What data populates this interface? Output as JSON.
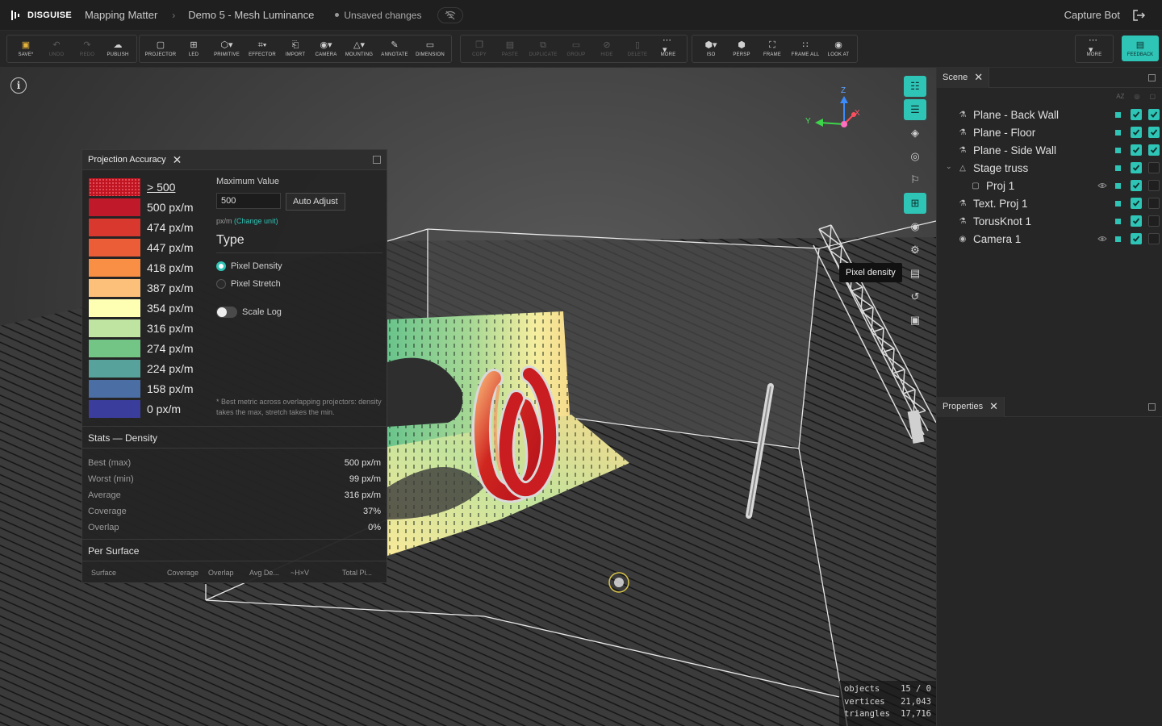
{
  "topbar": {
    "brand": "DISGUISE",
    "crumbs": [
      "Mapping Matter",
      "Demo 5 - Mesh Luminance"
    ],
    "unsaved": "Unsaved changes",
    "user": "Capture Bot"
  },
  "toolbar": {
    "file": [
      {
        "label": "SAVE*",
        "icon": "save-icon"
      },
      {
        "label": "UNDO",
        "icon": "undo-icon"
      },
      {
        "label": "REDO",
        "icon": "redo-icon"
      },
      {
        "label": "PUBLISH",
        "icon": "cloud-upload-icon"
      }
    ],
    "create": [
      {
        "label": "PROJECTOR",
        "icon": "projector-icon"
      },
      {
        "label": "LED",
        "icon": "led-grid-icon"
      },
      {
        "label": "PRIMITIVE",
        "icon": "cube-icon"
      },
      {
        "label": "EFFECTOR",
        "icon": "effector-grid-icon"
      },
      {
        "label": "IMPORT",
        "icon": "import-file-icon"
      },
      {
        "label": "CAMERA",
        "icon": "camera-icon"
      },
      {
        "label": "MOUNTING",
        "icon": "truss-icon"
      },
      {
        "label": "ANNOTATE",
        "icon": "pencil-icon"
      },
      {
        "label": "DIMENSION",
        "icon": "ruler-icon"
      }
    ],
    "edit": [
      {
        "label": "COPY",
        "icon": "copy-icon"
      },
      {
        "label": "PASTE",
        "icon": "paste-icon"
      },
      {
        "label": "DUPLICATE",
        "icon": "duplicate-icon"
      },
      {
        "label": "GROUP",
        "icon": "folder-icon"
      },
      {
        "label": "HIDE",
        "icon": "hide-icon"
      },
      {
        "label": "DELETE",
        "icon": "trash-icon"
      },
      {
        "label": "MORE",
        "icon": "more-icon"
      }
    ],
    "view": [
      {
        "label": "ISO",
        "icon": "iso-cube-icon"
      },
      {
        "label": "PERSP",
        "icon": "persp-cube-icon"
      },
      {
        "label": "FRAME",
        "icon": "frame-icon"
      },
      {
        "label": "FRAME ALL",
        "icon": "frame-all-icon"
      },
      {
        "label": "LOOK AT",
        "icon": "eye-icon"
      }
    ],
    "more": "MORE",
    "feedback": "FEEDBACK"
  },
  "viewport": {
    "tooltip": "Pixel density",
    "axes": {
      "z": "Z",
      "y": "Y",
      "x": "X"
    },
    "stats": [
      {
        "k": "objects",
        "v": "15 / 0"
      },
      {
        "k": "vertices",
        "v": "21,043"
      },
      {
        "k": "triangles",
        "v": "17,716"
      }
    ]
  },
  "accuracy": {
    "title": "Projection Accuracy",
    "legend": [
      {
        "label": "> 500",
        "color": "#c01421"
      },
      {
        "label": "500 px/m",
        "color": "#c0192a"
      },
      {
        "label": "474 px/m",
        "color": "#d8382d"
      },
      {
        "label": "447 px/m",
        "color": "#ea5d36"
      },
      {
        "label": "418 px/m",
        "color": "#f98e45"
      },
      {
        "label": "387 px/m",
        "color": "#fdc07a"
      },
      {
        "label": "354 px/m",
        "color": "#ffffb3"
      },
      {
        "label": "316 px/m",
        "color": "#bfe3a0"
      },
      {
        "label": "274 px/m",
        "color": "#73c586"
      },
      {
        "label": "224 px/m",
        "color": "#57a29a"
      },
      {
        "label": "158 px/m",
        "color": "#4b6ea5"
      },
      {
        "label": "0 px/m",
        "color": "#3b3d9c"
      }
    ],
    "max_label": "Maximum Value",
    "max_value": "500",
    "auto_adjust": "Auto Adjust",
    "unit": "px/m",
    "change_unit": "(Change unit)",
    "type_heading": "Type",
    "type_options": [
      "Pixel Density",
      "Pixel Stretch"
    ],
    "type_selected": "Pixel Density",
    "scale_log": "Scale Log",
    "scale_log_on": false,
    "note": "* Best metric across overlapping projectors: density takes the max, stretch takes the min.",
    "stats_heading": "Stats — Density",
    "stats": [
      {
        "k": "Best (max)",
        "v": "500 px/m"
      },
      {
        "k": "Worst (min)",
        "v": "99 px/m"
      },
      {
        "k": "Average",
        "v": "316 px/m"
      },
      {
        "k": "Coverage",
        "v": "37%"
      },
      {
        "k": "Overlap",
        "v": "0%"
      }
    ],
    "per_surface_heading": "Per Surface",
    "per_surface_columns": [
      "Surface",
      "Coverage",
      "Overlap",
      "Avg De...",
      "~H×V",
      "Total Pi..."
    ]
  },
  "scene": {
    "tab": "Scene",
    "sort": "AZ",
    "items": [
      {
        "name": "Plane - Back Wall",
        "icon": "plane-icon",
        "level": 0,
        "vis1": true,
        "vis2": true,
        "eye": false
      },
      {
        "name": "Plane - Floor",
        "icon": "plane-icon",
        "level": 0,
        "vis1": true,
        "vis2": true,
        "eye": false
      },
      {
        "name": "Plane - Side Wall",
        "icon": "plane-icon",
        "level": 0,
        "vis1": true,
        "vis2": true,
        "eye": false
      },
      {
        "name": "Stage truss",
        "icon": "truss-icon",
        "level": 0,
        "vis1": true,
        "vis2": false,
        "eye": false,
        "expanded": true
      },
      {
        "name": "Proj 1",
        "icon": "projector-icon",
        "level": 1,
        "vis1": true,
        "vis2": false,
        "eye": true
      },
      {
        "name": "Text. Proj 1",
        "icon": "plane-icon",
        "level": 0,
        "vis1": true,
        "vis2": false,
        "eye": false
      },
      {
        "name": "TorusKnot 1",
        "icon": "plane-icon",
        "level": 0,
        "vis1": true,
        "vis2": false,
        "eye": false
      },
      {
        "name": "Camera 1",
        "icon": "camera-icon",
        "level": 0,
        "vis1": true,
        "vis2": false,
        "eye": true
      }
    ]
  },
  "properties": {
    "tab": "Properties"
  },
  "rail": [
    {
      "icon": "hierarchy-icon",
      "on": true
    },
    {
      "icon": "sliders-icon",
      "on": true
    },
    {
      "icon": "layers-icon",
      "on": false
    },
    {
      "icon": "compass-icon",
      "on": false
    },
    {
      "icon": "thermometer-icon",
      "on": false
    },
    {
      "icon": "pixel-density-icon",
      "on": true
    },
    {
      "icon": "camera-icon",
      "on": false
    },
    {
      "icon": "settings-icon",
      "on": false
    },
    {
      "icon": "document-icon",
      "on": false
    },
    {
      "icon": "history-icon",
      "on": false
    },
    {
      "icon": "image-icon",
      "on": false
    }
  ]
}
